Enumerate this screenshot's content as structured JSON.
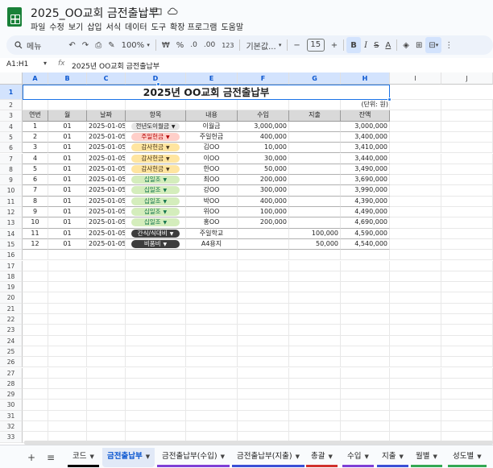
{
  "app": {
    "title": "2025_OO교회 금전출납부",
    "menu": [
      "파일",
      "수정",
      "보기",
      "삽입",
      "서식",
      "데이터",
      "도구",
      "확장 프로그램",
      "도움말"
    ]
  },
  "toolbar": {
    "search_label": "메뉴",
    "zoom": "100%",
    "currency": "₩",
    "percent": "%",
    "dec_decrease": ".0",
    "dec_increase": ".00",
    "number_format": "123",
    "font_name": "기본값...",
    "font_size": "15",
    "minus": "−",
    "plus": "+",
    "bold": "B",
    "italic": "I",
    "strike": "S",
    "text_color": "A"
  },
  "formula_bar": {
    "name_box": "A1:H1",
    "fx": "fx",
    "content": "2025년 OO교회 금전출납부"
  },
  "grid": {
    "columns": [
      "A",
      "B",
      "C",
      "D",
      "E",
      "F",
      "G",
      "H",
      "I",
      "J"
    ],
    "rows": [
      "1",
      "2",
      "3",
      "4",
      "5",
      "6",
      "7",
      "8",
      "9",
      "10",
      "11",
      "12",
      "13",
      "14",
      "15",
      "16",
      "17",
      "18",
      "19",
      "20",
      "21",
      "22",
      "23",
      "24",
      "25",
      "26",
      "27",
      "28",
      "29",
      "30",
      "31",
      "32",
      "33"
    ],
    "title": "2025년 OO교회 금전출납부",
    "unit_note": "(단위: 원)",
    "headers": [
      "연번",
      "월",
      "날짜",
      "항목",
      "내용",
      "수입",
      "지출",
      "잔액"
    ],
    "records": [
      {
        "no": "1",
        "month": "01",
        "date": "2025-01-05",
        "item": "전년도이월금",
        "chip": "gray",
        "desc": "이월금",
        "income": "3,000,000",
        "expense": "",
        "balance": "3,000,000"
      },
      {
        "no": "2",
        "month": "01",
        "date": "2025-01-05",
        "item": "주일헌금",
        "chip": "red",
        "desc": "주일헌금",
        "income": "400,000",
        "expense": "",
        "balance": "3,400,000"
      },
      {
        "no": "3",
        "month": "01",
        "date": "2025-01-05",
        "item": "감사헌금",
        "chip": "yellow",
        "desc": "김OO",
        "income": "10,000",
        "expense": "",
        "balance": "3,410,000"
      },
      {
        "no": "4",
        "month": "01",
        "date": "2025-01-05",
        "item": "감사헌금",
        "chip": "yellow",
        "desc": "이OO",
        "income": "30,000",
        "expense": "",
        "balance": "3,440,000"
      },
      {
        "no": "5",
        "month": "01",
        "date": "2025-01-05",
        "item": "감사헌금",
        "chip": "yellow",
        "desc": "한OO",
        "income": "50,000",
        "expense": "",
        "balance": "3,490,000"
      },
      {
        "no": "6",
        "month": "01",
        "date": "2025-01-05",
        "item": "십일조",
        "chip": "green",
        "desc": "최OO",
        "income": "200,000",
        "expense": "",
        "balance": "3,690,000"
      },
      {
        "no": "7",
        "month": "01",
        "date": "2025-01-05",
        "item": "십일조",
        "chip": "green",
        "desc": "강OO",
        "income": "300,000",
        "expense": "",
        "balance": "3,990,000"
      },
      {
        "no": "8",
        "month": "01",
        "date": "2025-01-05",
        "item": "십일조",
        "chip": "green",
        "desc": "박OO",
        "income": "400,000",
        "expense": "",
        "balance": "4,390,000"
      },
      {
        "no": "9",
        "month": "01",
        "date": "2025-01-05",
        "item": "십일조",
        "chip": "green",
        "desc": "위OO",
        "income": "100,000",
        "expense": "",
        "balance": "4,490,000"
      },
      {
        "no": "10",
        "month": "01",
        "date": "2025-01-05",
        "item": "십일조",
        "chip": "green",
        "desc": "홍OO",
        "income": "200,000",
        "expense": "",
        "balance": "4,690,000"
      },
      {
        "no": "11",
        "month": "01",
        "date": "2025-01-05",
        "item": "간식/식대비",
        "chip": "dark",
        "desc": "주일학교",
        "income": "",
        "expense": "100,000",
        "balance": "4,590,000"
      },
      {
        "no": "12",
        "month": "01",
        "date": "2025-01-05",
        "item": "비품비",
        "chip": "dark",
        "desc": "A4용지",
        "income": "",
        "expense": "50,000",
        "balance": "4,540,000"
      }
    ]
  },
  "chip_colors": {
    "gray": {
      "bg": "#e6e6e6",
      "fg": "#1f1f1f"
    },
    "red": {
      "bg": "#ffcfc9",
      "fg": "#b10202"
    },
    "yellow": {
      "bg": "#ffe5a0",
      "fg": "#473821"
    },
    "green": {
      "bg": "#d4edbc",
      "fg": "#11734b"
    },
    "dark": {
      "bg": "#3d3d3d",
      "fg": "#ffffff"
    }
  },
  "tabs": [
    {
      "label": "코드",
      "active": false,
      "underline": "#000000"
    },
    {
      "label": "금전출납부",
      "active": true,
      "underline": ""
    },
    {
      "label": "금전출납부(수입)",
      "active": false,
      "underline": "#7e3fd6"
    },
    {
      "label": "금전출납부(지출)",
      "active": false,
      "underline": "#3b4fd6"
    },
    {
      "label": "총괄",
      "active": false,
      "underline": "#d0312d"
    },
    {
      "label": "수입",
      "active": false,
      "underline": "#7e3fd6"
    },
    {
      "label": "지출",
      "active": false,
      "underline": "#3b4fd6"
    },
    {
      "label": "월별",
      "active": false,
      "underline": "#34a853"
    },
    {
      "label": "성도별",
      "active": false,
      "underline": "#34a853"
    }
  ]
}
